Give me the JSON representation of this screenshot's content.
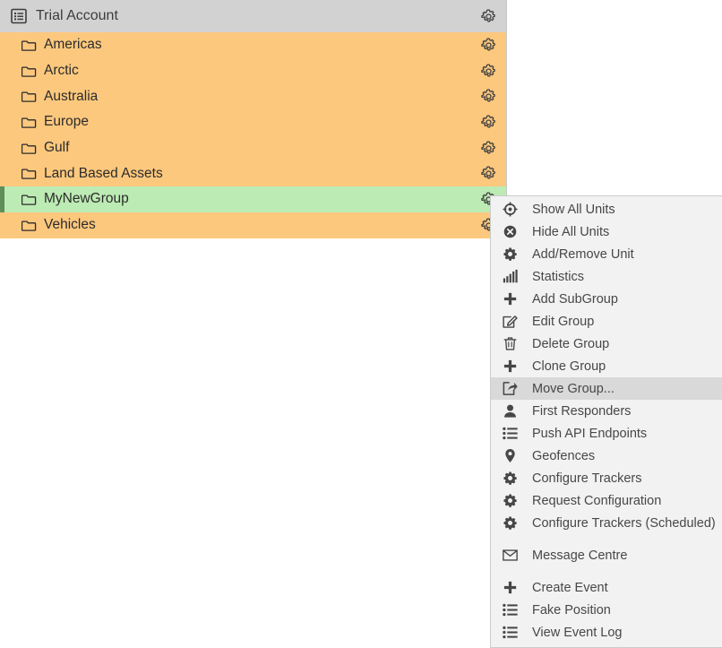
{
  "tree": {
    "header": {
      "icon": "list-box-icon",
      "label": "Trial Account",
      "gear_icon": "gear-outline-icon"
    },
    "row_gear_icon": "gear-outline-icon",
    "folder_icon": "folder-outline-icon",
    "colors": {
      "header_bg": "#d2d2d2",
      "row_bg": "#fcc87e",
      "selected_bg": "#bcebb4",
      "selected_accent": "#5f8f59",
      "text": "#2b2b2b",
      "panel_border": "#c8c8c8"
    },
    "rows": [
      {
        "label": "Americas",
        "state": "normal"
      },
      {
        "label": "Arctic",
        "state": "normal"
      },
      {
        "label": "Australia",
        "state": "normal"
      },
      {
        "label": "Europe",
        "state": "normal"
      },
      {
        "label": "Gulf",
        "state": "normal"
      },
      {
        "label": "Land Based Assets",
        "state": "normal"
      },
      {
        "label": "MyNewGroup",
        "state": "selected"
      },
      {
        "label": "Vehicles",
        "state": "normal"
      }
    ]
  },
  "context_menu": {
    "colors": {
      "bg": "#f2f2f2",
      "border": "#cccccc",
      "hover_bg": "#d9d9d9",
      "text": "#474747"
    },
    "items": [
      {
        "label": "Show All Units",
        "icon": "crosshair-icon",
        "active": false,
        "gap_after": false
      },
      {
        "label": "Hide All Units",
        "icon": "circle-x-icon",
        "active": false,
        "gap_after": false
      },
      {
        "label": "Add/Remove Unit",
        "icon": "gear-icon",
        "active": false,
        "gap_after": false
      },
      {
        "label": "Statistics",
        "icon": "bar-chart-icon",
        "active": false,
        "gap_after": false
      },
      {
        "label": "Add SubGroup",
        "icon": "plus-icon",
        "active": false,
        "gap_after": false
      },
      {
        "label": "Edit Group",
        "icon": "edit-pencil-icon",
        "active": false,
        "gap_after": false
      },
      {
        "label": "Delete Group",
        "icon": "trash-icon",
        "active": false,
        "gap_after": false
      },
      {
        "label": "Clone Group",
        "icon": "plus-icon",
        "active": false,
        "gap_after": false
      },
      {
        "label": "Move Group...",
        "icon": "share-arrow-icon",
        "active": true,
        "gap_after": false
      },
      {
        "label": "First Responders",
        "icon": "person-icon",
        "active": false,
        "gap_after": false
      },
      {
        "label": "Push API Endpoints",
        "icon": "list-icon",
        "active": false,
        "gap_after": false
      },
      {
        "label": "Geofences",
        "icon": "map-pin-icon",
        "active": false,
        "gap_after": false
      },
      {
        "label": "Configure Trackers",
        "icon": "gear-icon",
        "active": false,
        "gap_after": false
      },
      {
        "label": "Request Configuration",
        "icon": "gear-icon",
        "active": false,
        "gap_after": false
      },
      {
        "label": "Configure Trackers (Scheduled)",
        "icon": "gear-icon",
        "active": false,
        "gap_after": true
      },
      {
        "label": "Message Centre",
        "icon": "envelope-icon",
        "active": false,
        "gap_after": true
      },
      {
        "label": "Create Event",
        "icon": "plus-icon",
        "active": false,
        "gap_after": false
      },
      {
        "label": "Fake Position",
        "icon": "list-icon",
        "active": false,
        "gap_after": false
      },
      {
        "label": "View Event Log",
        "icon": "list-icon",
        "active": false,
        "gap_after": false
      }
    ]
  }
}
